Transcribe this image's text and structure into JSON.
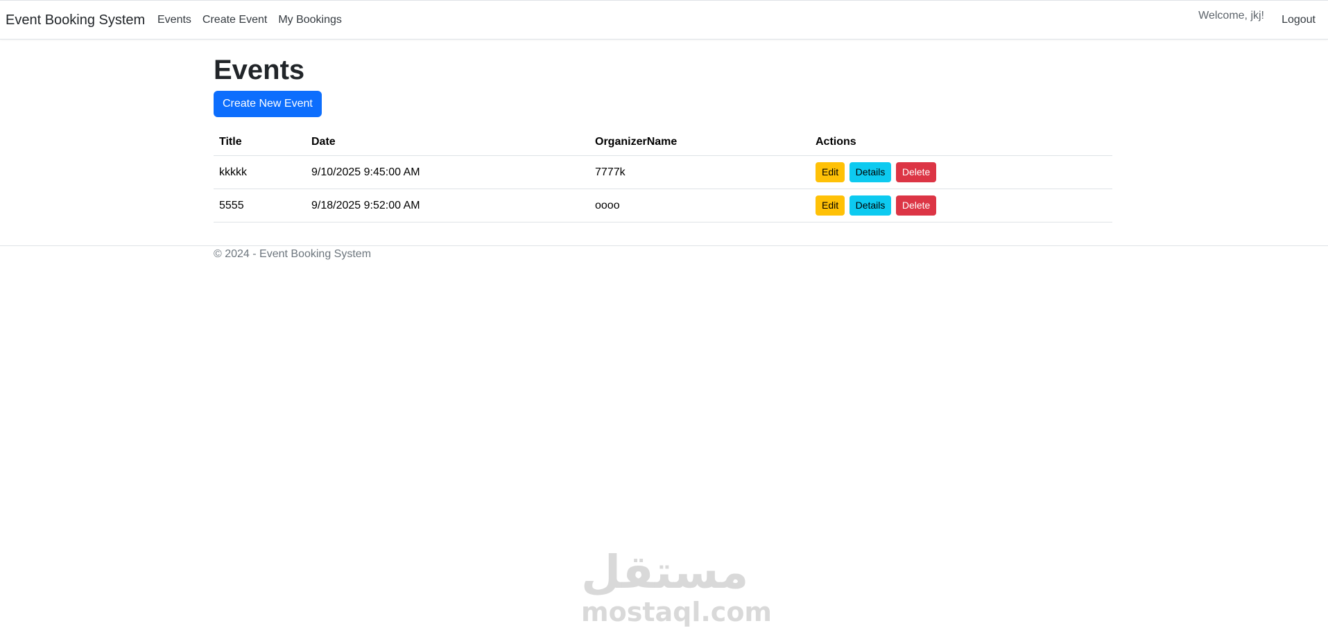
{
  "navbar": {
    "brand": "Event Booking System",
    "links": [
      "Events",
      "Create Event",
      "My Bookings"
    ],
    "welcome": "Welcome, jkj!",
    "logout": "Logout"
  },
  "main": {
    "title": "Events",
    "create_button": "Create New Event",
    "table": {
      "headers": [
        "Title",
        "Date",
        "OrganizerName",
        "Actions"
      ],
      "rows": [
        {
          "title": "kkkkk",
          "date": "9/10/2025 9:45:00 AM",
          "organizer": "7777k"
        },
        {
          "title": "5555",
          "date": "9/18/2025 9:52:00 AM",
          "organizer": "oooo"
        }
      ],
      "actions": {
        "edit": "Edit",
        "details": "Details",
        "delete": "Delete"
      }
    }
  },
  "footer": {
    "text": "© 2024 - Event Booking System"
  },
  "watermark": {
    "arabic": "مستقل",
    "latin": "mostaql.com"
  },
  "colors": {
    "primary": "#0d6efd",
    "warning": "#ffc107",
    "info": "#0dcaf0",
    "danger": "#dc3545"
  }
}
